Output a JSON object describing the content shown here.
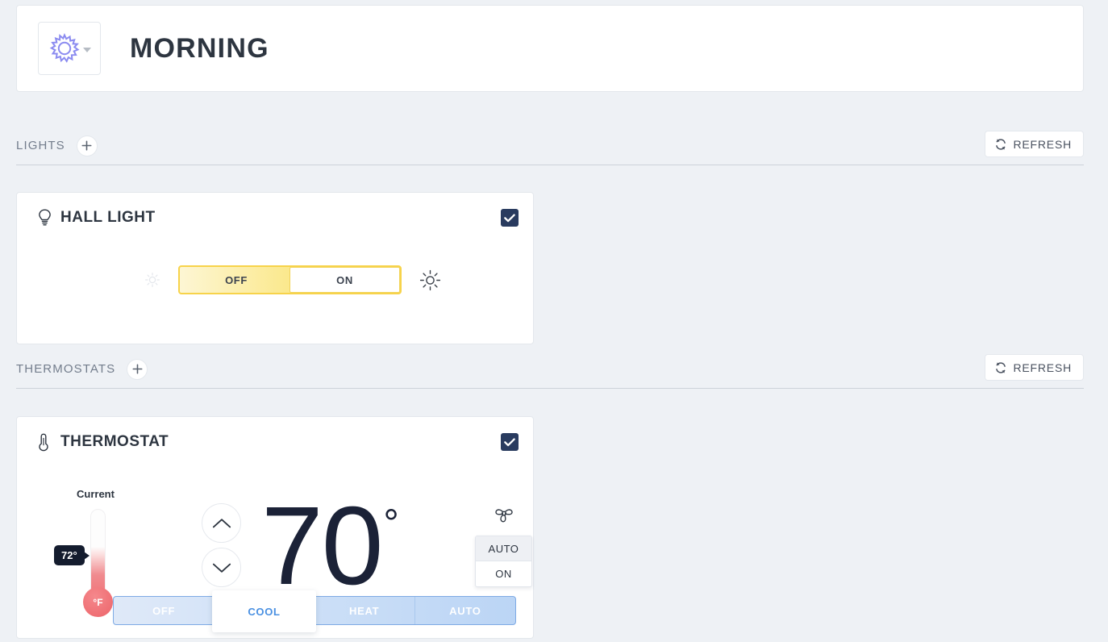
{
  "scene": {
    "title": "MORNING",
    "icon": "sun-icon",
    "dropdown_caret": "chevron-down-icon"
  },
  "sections": [
    {
      "label": "LIGHTS",
      "add_label": "+",
      "refresh_label": "REFRESH"
    },
    {
      "label": "THERMOSTATS",
      "add_label": "+",
      "refresh_label": "REFRESH"
    }
  ],
  "light_card": {
    "icon": "lightbulb-icon",
    "title": "HALL LIGHT",
    "enabled": true,
    "dim_low_icon": "sun-dim-icon",
    "dim_high_icon": "sun-bright-icon",
    "slider": {
      "off_label": "OFF",
      "on_label": "ON",
      "state": "ON",
      "thumb_position_pct": 50
    }
  },
  "thermostat_card": {
    "icon": "thermometer-icon",
    "title": "THERMOSTAT",
    "enabled": true,
    "current_label": "Current",
    "current_temp": "72°",
    "unit_label": "°F",
    "target_temp": "70",
    "target_degree": "°",
    "step_up_icon": "chevron-up-icon",
    "step_down_icon": "chevron-down-icon",
    "fan": {
      "icon": "fan-icon",
      "options": [
        "AUTO",
        "ON"
      ],
      "selected": "AUTO"
    },
    "modes": {
      "options": [
        "OFF",
        "COOL",
        "HEAT",
        "AUTO"
      ],
      "selected": "COOL"
    }
  },
  "colors": {
    "page_bg": "#eef1f5",
    "card_bg": "#ffffff",
    "accent_dark": "#293b5f",
    "light_yellow": "#f7d34a",
    "cool_blue": "#4a90e2",
    "hot_red": "#ef6f74",
    "scene_icon_purple": "#8b8bf0"
  }
}
